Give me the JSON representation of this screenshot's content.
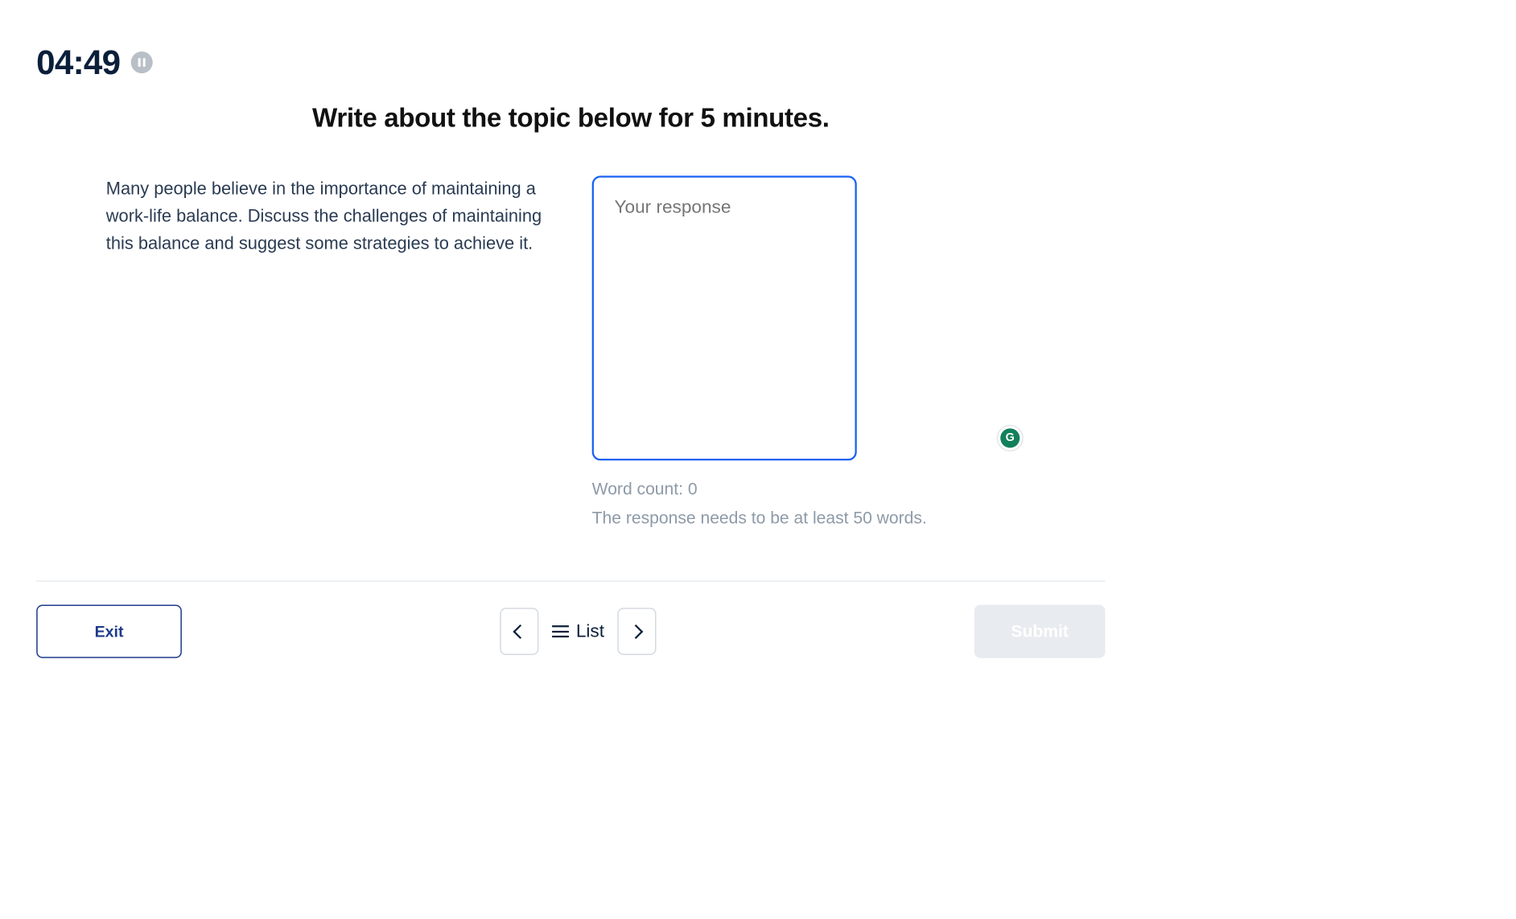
{
  "timer": {
    "value": "04:49"
  },
  "heading": "Write about the topic below for 5 minutes.",
  "prompt": "Many people believe in the importance of maintaining a work-life balance. Discuss the challenges of maintaining this balance and suggest some strategies to achieve it.",
  "response": {
    "placeholder": "Your response",
    "value": "",
    "word_count_label": "Word count: 0",
    "min_words_label": "The response needs to be at least 50 words."
  },
  "grammarly": {
    "glyph": "G"
  },
  "footer": {
    "exit_label": "Exit",
    "list_label": "List",
    "submit_label": "Submit"
  }
}
